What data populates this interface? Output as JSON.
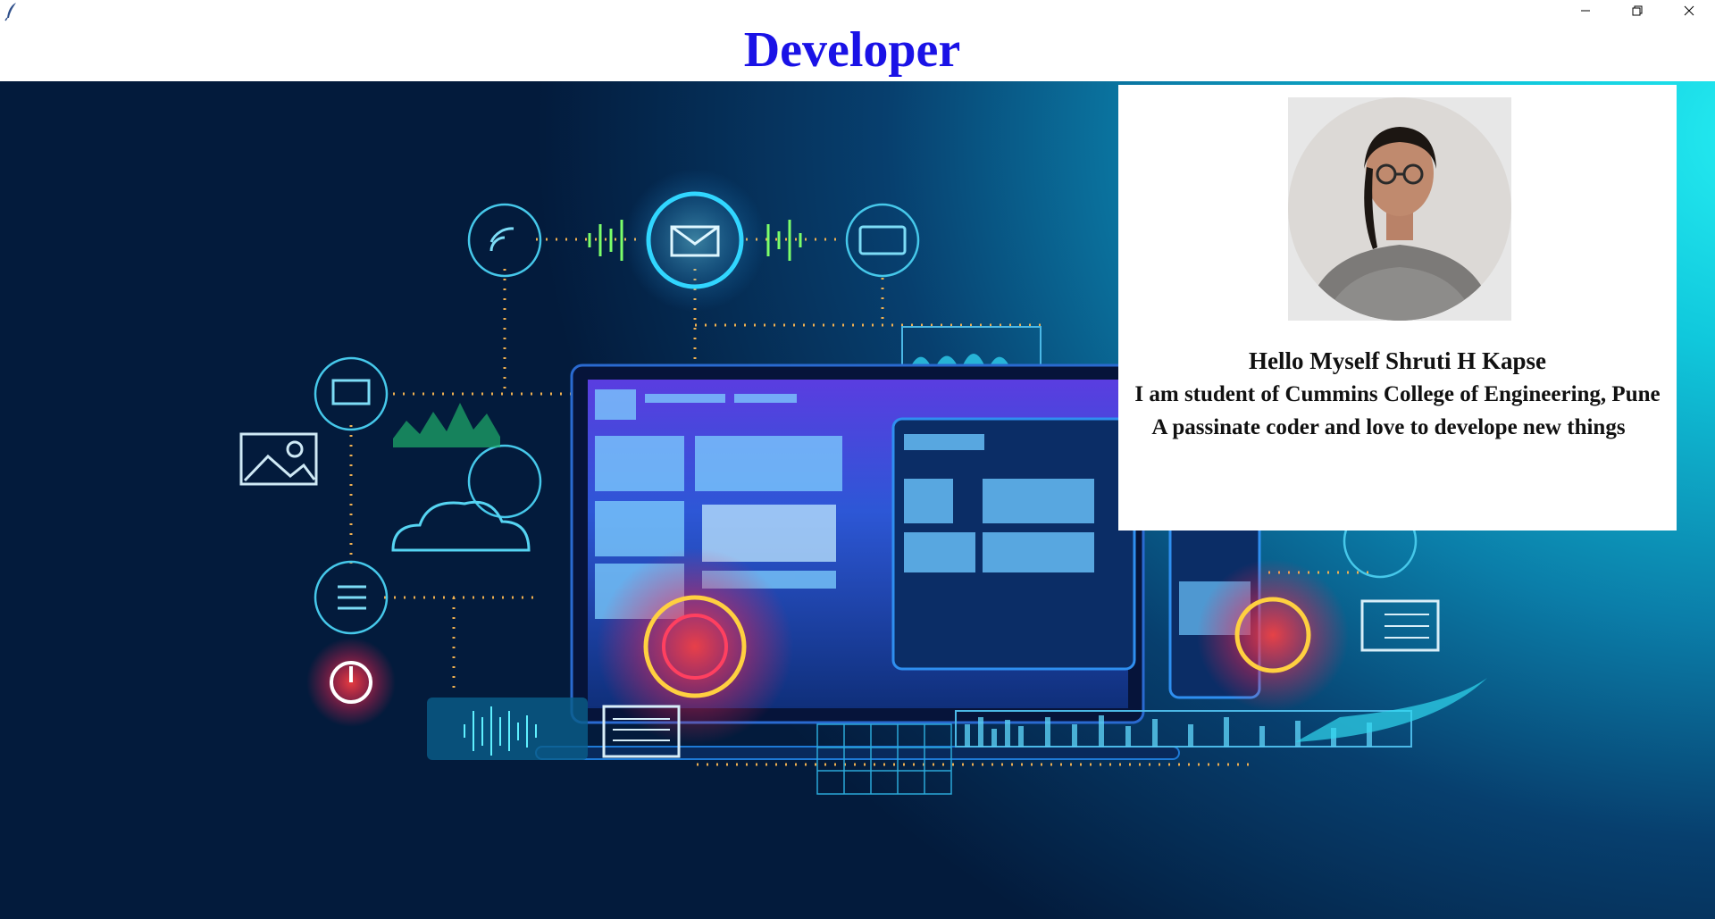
{
  "window": {
    "icon": "feather-icon",
    "controls": [
      "minimize-icon",
      "restore-icon",
      "close-icon"
    ]
  },
  "header": {
    "title": "Developer"
  },
  "colors": {
    "title": "#1a12e6",
    "card_bg": "#ffffff",
    "text": "#111111"
  },
  "profile": {
    "greeting": "Hello Myself Shruti H Kapse",
    "college": "I am student of Cummins College of Engineering, Pune",
    "tagline": "A passinate coder and love to develope new things"
  }
}
